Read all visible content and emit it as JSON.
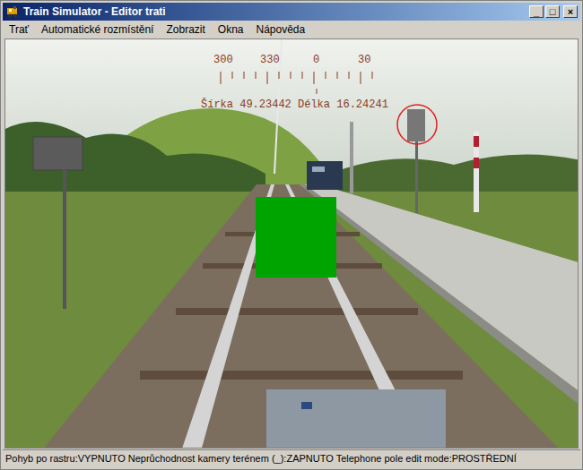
{
  "window": {
    "title": "Train Simulator - Editor trati",
    "controls": [
      "_",
      "□",
      "×"
    ]
  },
  "menu": [
    "Trať",
    "Automatické rozmístění",
    "Zobrazit",
    "Okna",
    "Nápověda"
  ],
  "hud": {
    "compass": [
      "300",
      "330",
      "0",
      "30"
    ],
    "coordinates": "Šírka 49.23442 Délka 16.24241"
  },
  "status_bar": "Pohyb po rastru:VYPNUTO Neprůchodnost kamery terénem (_):ZAPNUTO Telephone pole edit mode:PROSTŘEDNÍ"
}
